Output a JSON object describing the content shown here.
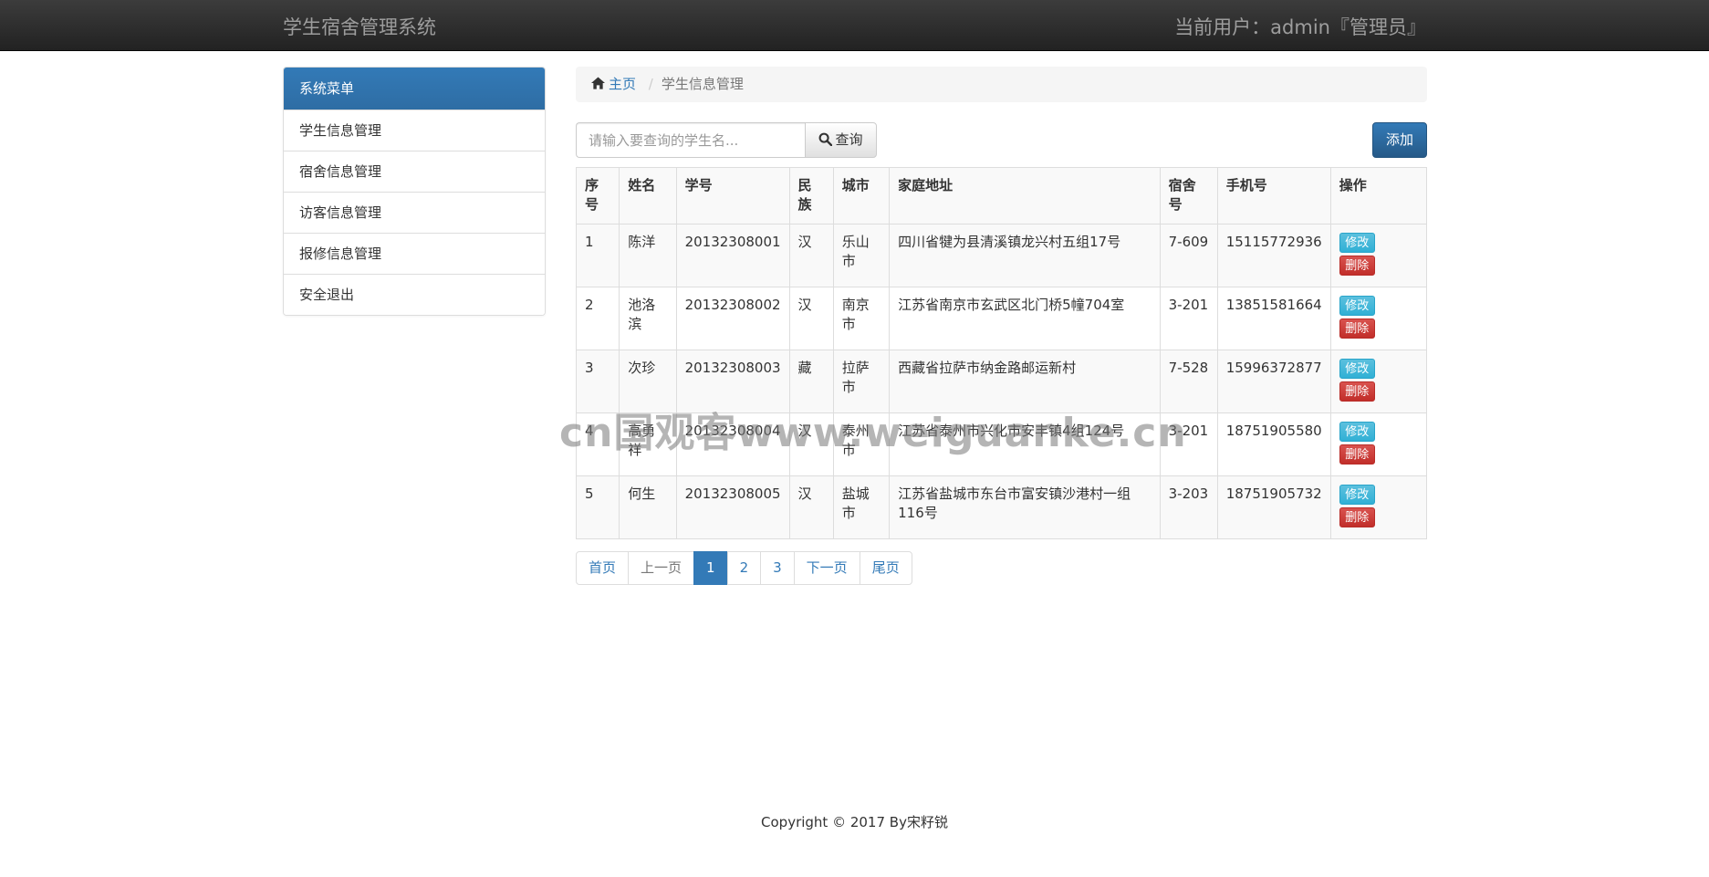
{
  "navbar": {
    "brand": "学生宿舍管理系统",
    "current_user": "当前用户：admin『管理员』"
  },
  "sidebar": {
    "heading": "系统菜单",
    "items": [
      {
        "label": "学生信息管理"
      },
      {
        "label": "宿舍信息管理"
      },
      {
        "label": "访客信息管理"
      },
      {
        "label": "报修信息管理"
      },
      {
        "label": "安全退出"
      }
    ]
  },
  "breadcrumb": {
    "home": "主页",
    "current": "学生信息管理"
  },
  "search": {
    "placeholder": "请输入要查询的学生名...",
    "button": "查询"
  },
  "add_button": "添加",
  "table": {
    "headers": [
      "序号",
      "姓名",
      "学号",
      "民族",
      "城市",
      "家庭地址",
      "宿舍号",
      "手机号",
      "操作"
    ],
    "rows": [
      {
        "no": "1",
        "name": "陈洋",
        "sid": "20132308001",
        "ethnic": "汉",
        "city": "乐山市",
        "address": "四川省犍为县清溪镇龙兴村五组17号",
        "dorm": "7-609",
        "phone": "15115772936"
      },
      {
        "no": "2",
        "name": "池洛滨",
        "sid": "20132308002",
        "ethnic": "汉",
        "city": "南京市",
        "address": "江苏省南京市玄武区北门桥5幢704室",
        "dorm": "3-201",
        "phone": "13851581664"
      },
      {
        "no": "3",
        "name": "次珍",
        "sid": "20132308003",
        "ethnic": "藏",
        "city": "拉萨市",
        "address": "西藏省拉萨市纳金路邮运新村",
        "dorm": "7-528",
        "phone": "15996372877"
      },
      {
        "no": "4",
        "name": "高勇祥",
        "sid": "20132308004",
        "ethnic": "汉",
        "city": "泰州市",
        "address": "江苏省泰州市兴化市安丰镇4组124号",
        "dorm": "3-201",
        "phone": "18751905580"
      },
      {
        "no": "5",
        "name": "何生",
        "sid": "20132308005",
        "ethnic": "汉",
        "city": "盐城市",
        "address": "江苏省盐城市东台市富安镇沙港村一组116号",
        "dorm": "3-203",
        "phone": "18751905732"
      }
    ],
    "edit_label": "修改",
    "delete_label": "删除"
  },
  "pagination": {
    "first": "首页",
    "prev": "上一页",
    "pages": [
      "1",
      "2",
      "3"
    ],
    "active_page": "1",
    "next": "下一页",
    "last": "尾页"
  },
  "watermark": "cn国观客www.weiguanke.cn",
  "footer": "Copyright © 2017 By宋籽锐",
  "colors": {
    "primary": "#337ab7",
    "info": "#5bc0de",
    "danger": "#d9534f",
    "navbar": "#222222"
  }
}
